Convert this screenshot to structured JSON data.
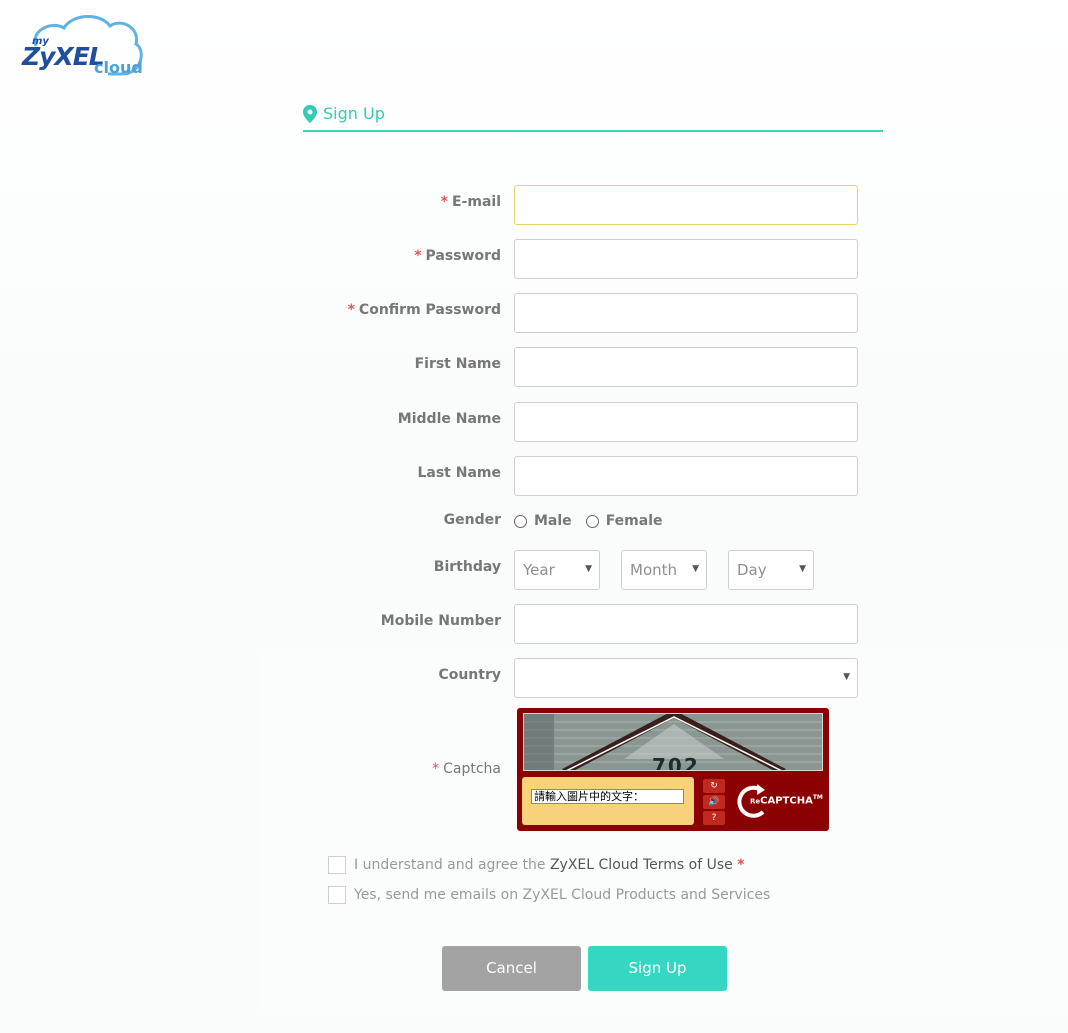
{
  "logo": {
    "my": "my",
    "brand": "ZyXEL",
    "cloud": "cloud"
  },
  "header": {
    "title": "Sign Up",
    "icon": "map-marker-icon",
    "accent_color": "#35c9b6"
  },
  "form": {
    "email_label": "E-mail",
    "password_label": "Password",
    "confirm_password_label": "Confirm Password",
    "first_name_label": "First Name",
    "middle_name_label": "Middle Name",
    "last_name_label": "Last Name",
    "gender_label": "Gender",
    "gender_options": [
      "Male",
      "Female"
    ],
    "birthday_label": "Birthday",
    "year_placeholder": "Year",
    "month_placeholder": "Month",
    "day_placeholder": "Day",
    "mobile_label": "Mobile Number",
    "country_label": "Country",
    "country_value": "",
    "captcha_label": "Captcha",
    "required_mark": "*"
  },
  "captcha": {
    "image_text": "702",
    "input_placeholder": "請輸入圖片中的文字：",
    "refresh_icon": "refresh-icon",
    "audio_icon": "audio-icon",
    "help_icon": "help-icon",
    "brand_re": "Re",
    "brand_text": "CAPTCHA",
    "brand_tm": "TM",
    "bg_color": "#8b0000"
  },
  "agreements": {
    "terms_prefix": "I understand and agree the ",
    "terms_link": "ZyXEL Cloud Terms of Use",
    "terms_required": "*",
    "newsletter": "Yes, send me emails on ZyXEL Cloud Products and Services"
  },
  "buttons": {
    "cancel": "Cancel",
    "signup": "Sign Up",
    "signup_color": "#35d6c2",
    "cancel_color": "#a3a3a3"
  }
}
